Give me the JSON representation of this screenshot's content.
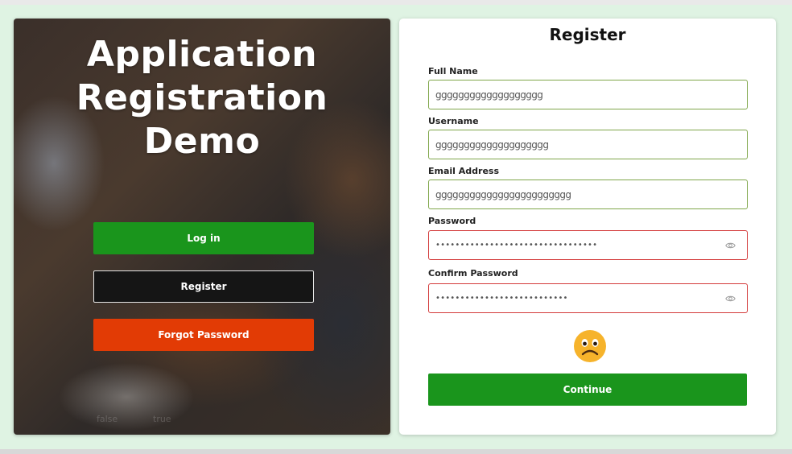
{
  "hero": {
    "line1": "Application",
    "line2": "Registration Demo"
  },
  "left_buttons": {
    "login": "Log in",
    "register": "Register",
    "forgot": "Forgot Password"
  },
  "faint_text": {
    "a": "false",
    "b": "true"
  },
  "form": {
    "title": "Register",
    "full_name": {
      "label": "Full Name",
      "value": "ggggggggggggggggggg"
    },
    "username": {
      "label": "Username",
      "value": "gggggggggggggggggggg"
    },
    "email": {
      "label": "Email Address",
      "value": "gggggggggggggggggggggggg"
    },
    "password": {
      "label": "Password",
      "value": "•••••••••••••••••••••••••••••••••"
    },
    "confirm_password": {
      "label": "Confirm Password",
      "value": "•••••••••••••••••••••••••••"
    },
    "status_icon": "sad-face-icon",
    "continue": "Continue"
  },
  "colors": {
    "primary_green": "#1a951c",
    "forgot_orange": "#e23b05",
    "valid_border": "#7fa64a",
    "error_border": "#d33a3a"
  }
}
